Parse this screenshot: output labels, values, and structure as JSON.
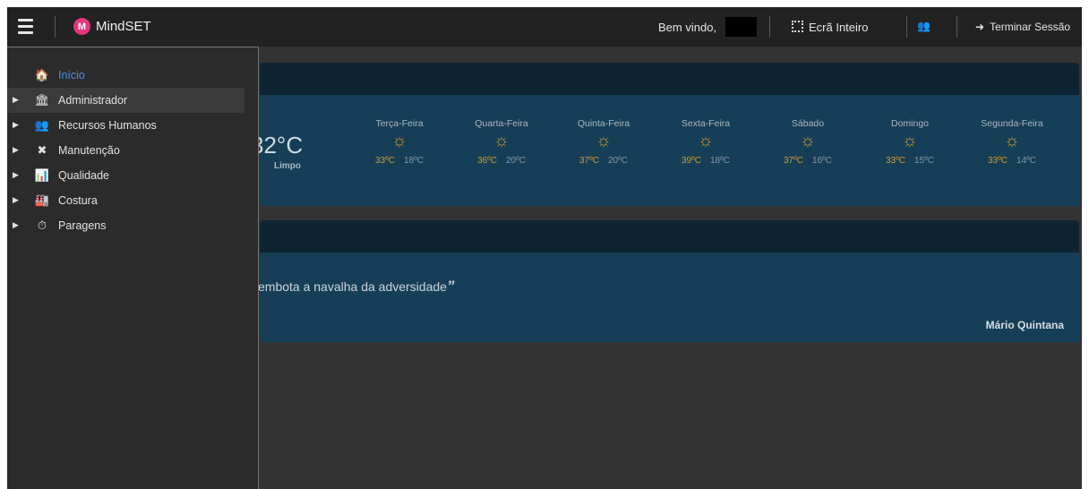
{
  "topbar": {
    "brand": "MindSET",
    "logo_letter": "M",
    "welcome": "Bem vindo,",
    "fullscreen_label": "Ecrã Inteiro",
    "users_icon": "👥",
    "logout_label": "Terminar Sessão",
    "logout_icon": "➜"
  },
  "sidebar": {
    "items": [
      {
        "label": "Início",
        "icon": "🏠",
        "active": true
      },
      {
        "label": "Administrador",
        "icon": "🏛"
      },
      {
        "label": "Recursos Humanos",
        "icon": "👥"
      },
      {
        "label": "Manutenção",
        "icon": "✖"
      },
      {
        "label": "Qualidade",
        "icon": "📊"
      },
      {
        "label": "Costura",
        "icon": "🏭"
      },
      {
        "label": "Paragens",
        "icon": "⏱"
      }
    ],
    "arrow": "▶"
  },
  "weather": {
    "current_temp": "32°C",
    "description": "Limpo",
    "sun_glyph": "☼",
    "days": [
      {
        "name": "Terça-Feira",
        "max": "33ºC",
        "min": "18ºC"
      },
      {
        "name": "Quarta-Feira",
        "max": "36ºC",
        "min": "20ºC"
      },
      {
        "name": "Quinta-Feira",
        "max": "37ºC",
        "min": "20ºC"
      },
      {
        "name": "Sexta-Feira",
        "max": "39ºC",
        "min": "18ºC"
      },
      {
        "name": "Sábado",
        "max": "37ºC",
        "min": "16ºC"
      },
      {
        "name": "Domingo",
        "max": "33ºC",
        "min": "15ºC"
      },
      {
        "name": "Segunda-Feira",
        "max": "33ºC",
        "min": "14ºC"
      }
    ]
  },
  "quote": {
    "text": "embota a navalha da adversidade",
    "close_mark": "”",
    "author": "Mário Quintana"
  }
}
